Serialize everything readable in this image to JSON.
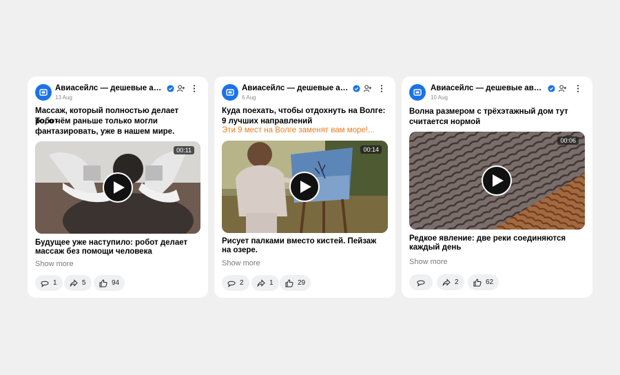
{
  "colors": {
    "accent": "#1a73e8",
    "promo": "#ef7b1f",
    "page_bg": "#f0f0f1"
  },
  "posts": [
    {
      "author": "Авиасейлс — дешевые авиа...",
      "date": "13 Aug",
      "title": "Массаж, который полностью делает робот",
      "subtitle": "То, о чём раньше только могли фантазировать, уже в нашем мире.",
      "duration": "00:11",
      "caption": "Будущее уже наступило: робот делает массаж без помощи человека",
      "show_more": "Show more",
      "comments": "1",
      "shares": "5",
      "likes": "94"
    },
    {
      "author": "Авиасейлс — дешевые авиа...",
      "date": "6 Aug",
      "title": "Куда поехать, чтобы отдохнуть на Волге: 9 лучших направлений",
      "promo": "Эти 9 мест на Волге заменят вам море!...",
      "duration": "00:14",
      "caption": "Рисует палками вместо кистей. Пейзаж на озере.",
      "show_more": "Show more",
      "comments": "2",
      "shares": "1",
      "likes": "29"
    },
    {
      "author": "Авиасейлс — дешевые авиа...",
      "date": "10 Aug",
      "title": "Волна размером с трёхэтажный дом тут считается нормой",
      "duration": "00:06",
      "caption": "Редкое явление: две реки соединяются каждый день",
      "show_more": "Show more",
      "comments": "",
      "shares": "2",
      "likes": "62"
    }
  ],
  "icons": {
    "avatar": "aviasales-logo-icon",
    "verified": "verified-badge-icon",
    "follow": "add-user-icon",
    "more": "more-vertical-icon",
    "play": "play-icon",
    "comment": "comment-icon",
    "share": "share-icon",
    "like": "thumbs-up-icon"
  }
}
